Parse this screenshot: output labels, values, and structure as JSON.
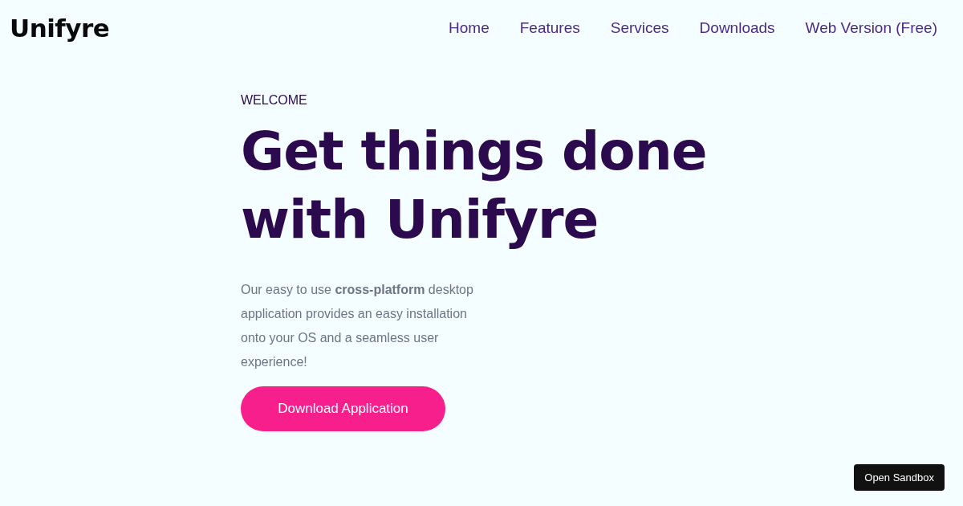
{
  "header": {
    "logo": "Unifyre",
    "nav": [
      {
        "label": "Home"
      },
      {
        "label": "Features"
      },
      {
        "label": "Services"
      },
      {
        "label": "Downloads"
      },
      {
        "label": "Web Version (Free)"
      }
    ]
  },
  "hero": {
    "eyebrow": "WELCOME",
    "title_lines": [
      "Get things done",
      "with Unifyre"
    ],
    "description": "Our easy to use **cross-platform** desktop application provides an easy installation onto your OS and a seamless user experience!",
    "button": "Download Application"
  },
  "sandbox_button": "Open Sandbox"
}
